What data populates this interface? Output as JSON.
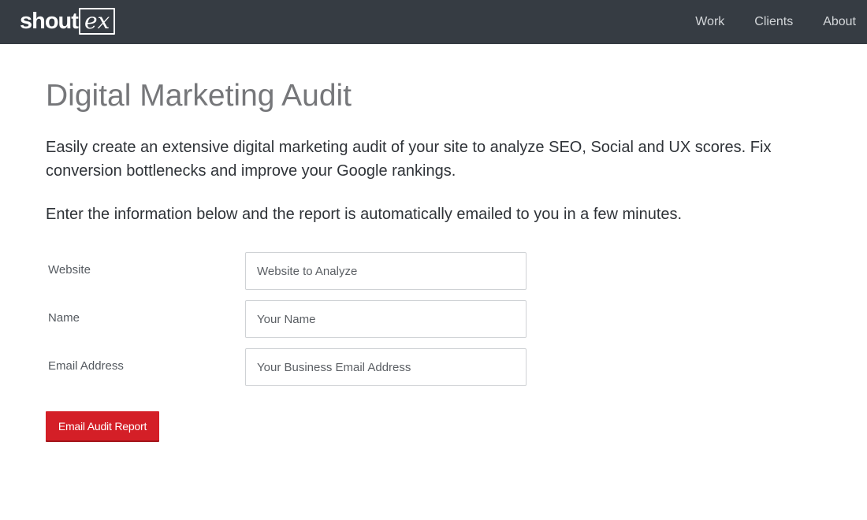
{
  "header": {
    "logo": {
      "main_text": "shout",
      "box_text": "ex"
    },
    "nav": [
      {
        "label": "Work"
      },
      {
        "label": "Clients"
      },
      {
        "label": "About"
      }
    ],
    "background_color": "#363c43"
  },
  "main": {
    "title": "Digital Marketing Audit",
    "intro": "Easily create an extensive digital marketing audit of your site to analyze SEO, Social and UX scores. Fix conversion bottlenecks and improve your Google rankings.",
    "instructions": "Enter the information below and the report is automatically emailed to you in a few minutes."
  },
  "form": {
    "fields": [
      {
        "label": "Website",
        "placeholder": "Website to Analyze",
        "value": ""
      },
      {
        "label": "Name",
        "placeholder": "Your Name",
        "value": ""
      },
      {
        "label": "Email Address",
        "placeholder": "Your Business Email Address",
        "value": ""
      }
    ],
    "submit_label": "Email Audit Report",
    "submit_color": "#d41f27"
  }
}
